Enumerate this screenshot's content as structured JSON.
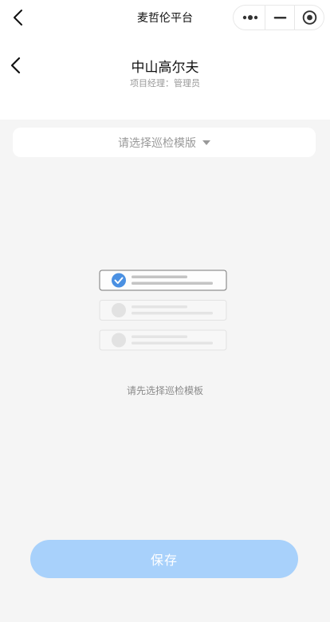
{
  "nav": {
    "title": "麦哲伦平台",
    "back_icon": "chevron-left-icon",
    "more_icon": "more-dots-icon",
    "minimize_icon": "minimize-icon",
    "close_icon": "target-close-icon"
  },
  "header": {
    "title": "中山高尔夫",
    "subtitle": "项目经理：管理员",
    "back_icon": "chevron-left-icon"
  },
  "template_select": {
    "placeholder": "请选择巡检模版",
    "caret_icon": "triangle-down-icon"
  },
  "empty_state": {
    "text": "请先选择巡检模板",
    "illustration_icon": "checklist-illustration-icon"
  },
  "actions": {
    "save_label": "保存"
  },
  "colors": {
    "accent": "#4a90e2",
    "save_button": "#a8d1fb",
    "background": "#f5f5f5"
  }
}
